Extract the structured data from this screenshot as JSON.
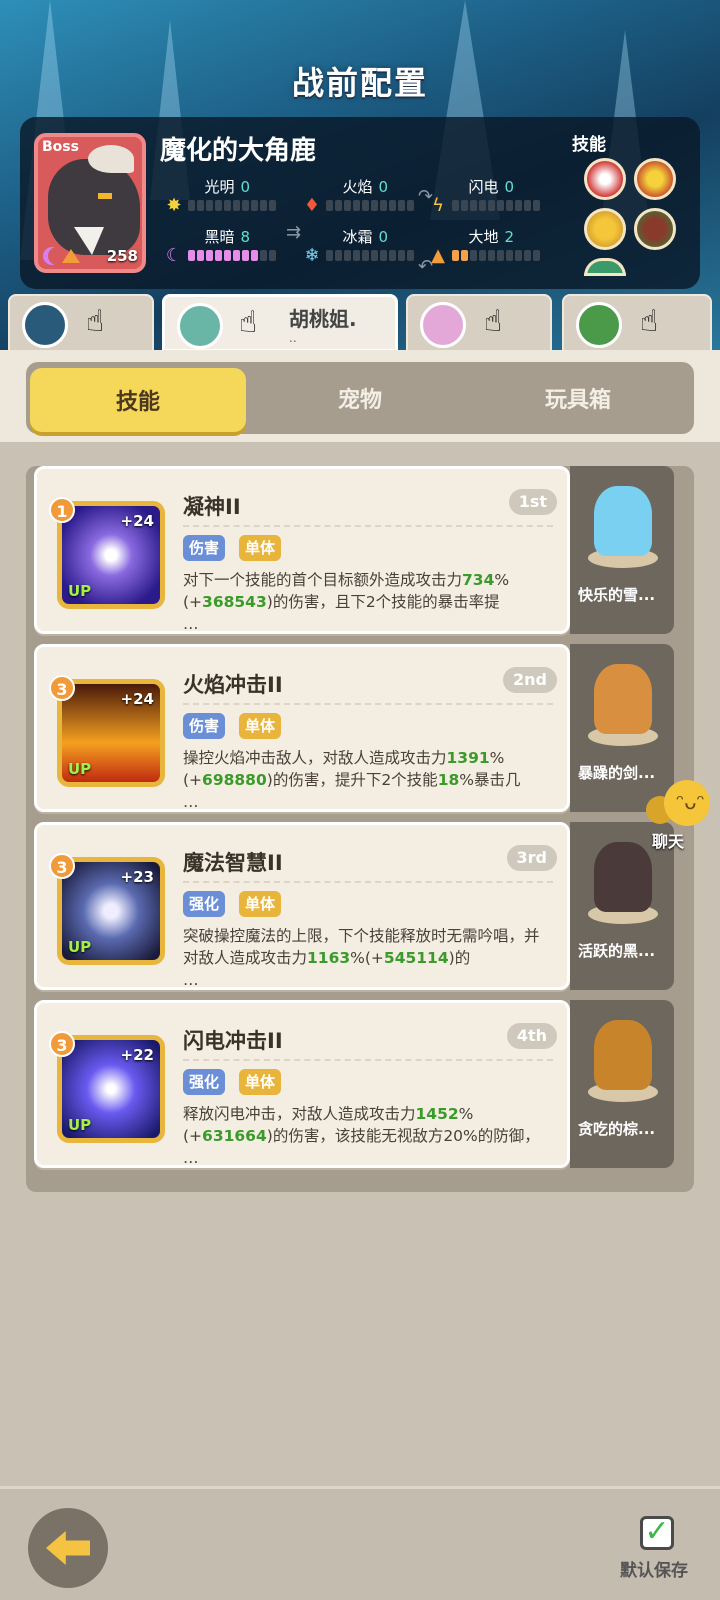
{
  "title": "战前配置",
  "boss": {
    "tag": "Boss",
    "level": "258",
    "name": "魔化的大角鹿",
    "elements": [
      {
        "label": "光明",
        "value": "0",
        "level": 0
      },
      {
        "label": "火焰",
        "value": "0",
        "level": 0
      },
      {
        "label": "闪电",
        "value": "0",
        "level": 0
      },
      {
        "label": "黑暗",
        "value": "8",
        "level": 8
      },
      {
        "label": "冰霜",
        "value": "0",
        "level": 0
      },
      {
        "label": "大地",
        "value": "2",
        "level": 2
      }
    ],
    "skills_label": "技能"
  },
  "party_tabs": [
    {
      "name": "",
      "sub": ""
    },
    {
      "name": "胡桃姐.",
      "sub": ".."
    },
    {
      "name": "",
      "sub": ""
    },
    {
      "name": "",
      "sub": ""
    }
  ],
  "section_tabs": [
    "技能",
    "宠物",
    "玩具箱"
  ],
  "skills": [
    {
      "rank": "1",
      "plus": "+24",
      "up": "UP",
      "name": "凝神II",
      "order": "1st",
      "tags": [
        "伤害",
        "单体"
      ],
      "desc": [
        {
          "t": "对下一个技能的首个目标额外造成攻击力"
        },
        {
          "g": "734"
        },
        {
          "t": "%(+"
        },
        {
          "g": "368543"
        },
        {
          "t": ")的伤害，且下2个技能的暴击率提\n…"
        }
      ]
    },
    {
      "rank": "3",
      "plus": "+24",
      "up": "UP",
      "name": "火焰冲击II",
      "order": "2nd",
      "tags": [
        "伤害",
        "单体"
      ],
      "desc": [
        {
          "t": "操控火焰冲击敌人，对敌人造成攻击力"
        },
        {
          "g": "1391"
        },
        {
          "t": "%(+"
        },
        {
          "g": "698880"
        },
        {
          "t": ")的伤害，提升下2个技能"
        },
        {
          "g": "18"
        },
        {
          "t": "%暴击几\n…"
        }
      ]
    },
    {
      "rank": "3",
      "plus": "+23",
      "up": "UP",
      "name": "魔法智慧II",
      "order": "3rd",
      "tags": [
        "强化",
        "单体"
      ],
      "desc": [
        {
          "t": "突破操控魔法的上限，下个技能释放时无需吟唱，并对敌人造成攻击力"
        },
        {
          "g": "1163"
        },
        {
          "t": "%(+"
        },
        {
          "g": "545114"
        },
        {
          "t": ")的\n…"
        }
      ]
    },
    {
      "rank": "3",
      "plus": "+22",
      "up": "UP",
      "name": "闪电冲击II",
      "order": "4th",
      "tags": [
        "强化",
        "单体"
      ],
      "desc": [
        {
          "t": "释放闪电冲击，对敌人造成攻击力"
        },
        {
          "g": "1452"
        },
        {
          "t": "%(+"
        },
        {
          "g": "631664"
        },
        {
          "t": ")的伤害，该技能无视敌方20%的防御，\n…"
        }
      ]
    }
  ],
  "pets": [
    "快乐的雪...",
    "暴躁的剑...",
    "活跃的黑...",
    "贪吃的棕..."
  ],
  "chat_label": "聊天",
  "save_label": "默认保存",
  "colors": {
    "accent": "#f5d75a",
    "green": "#3a9a2a",
    "panel": "#a69d8e"
  }
}
